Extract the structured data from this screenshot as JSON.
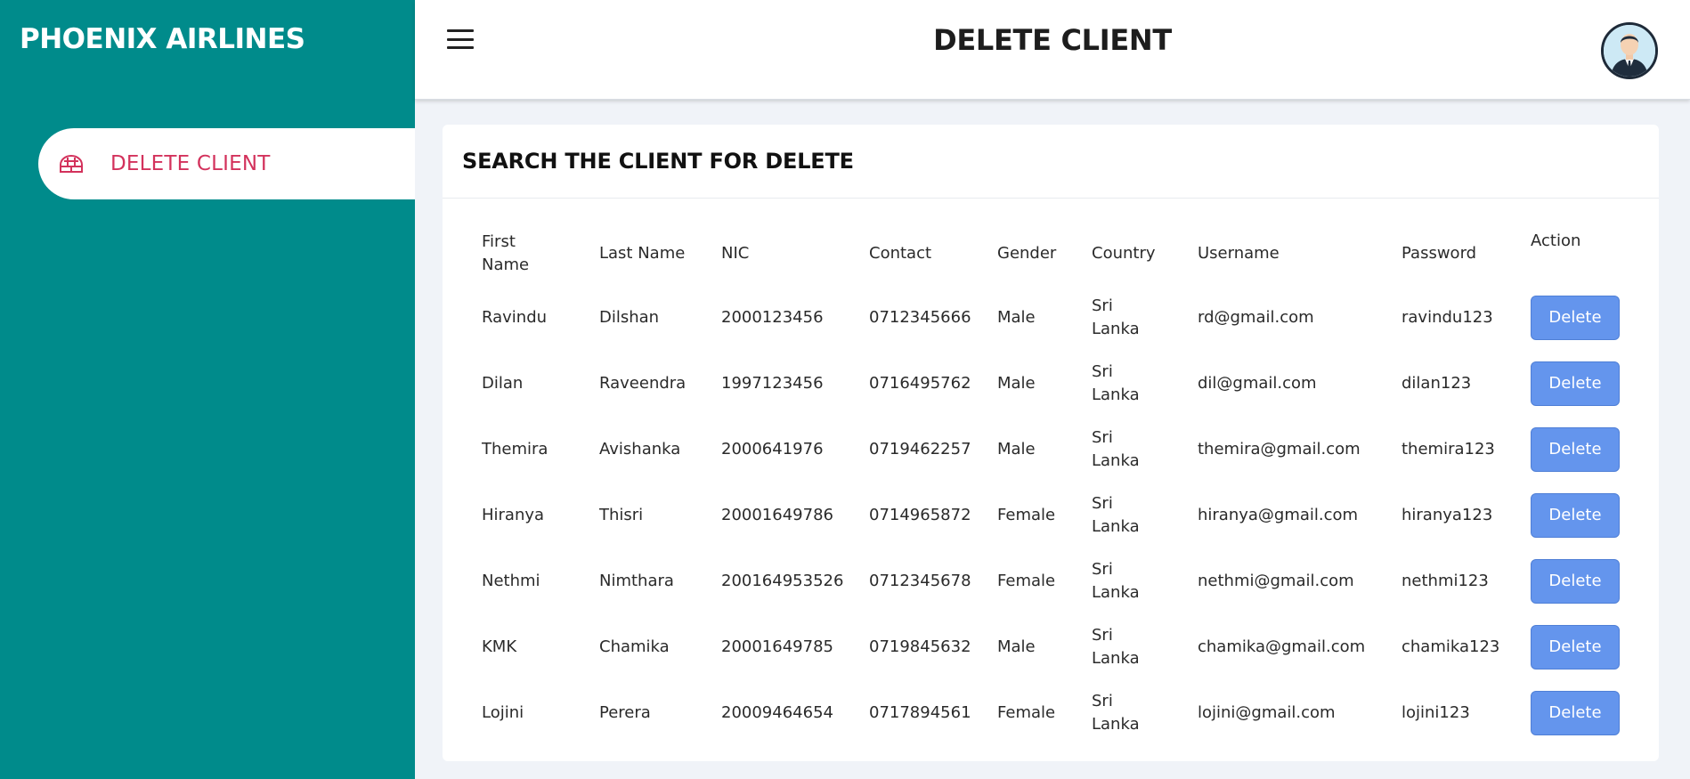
{
  "sidebar": {
    "brand": "PHOENIX AIRLINES",
    "items": [
      {
        "label": "DELETE CLIENT",
        "icon": "igloo-icon"
      }
    ]
  },
  "header": {
    "title": "DELETE CLIENT",
    "avatar_icon": "user-avatar"
  },
  "card": {
    "title": "SEARCH THE CLIENT FOR DELETE"
  },
  "table": {
    "columns": [
      "First Name",
      "Last Name",
      "NIC",
      "Contact",
      "Gender",
      "Country",
      "Username",
      "Password",
      "Action"
    ],
    "rows": [
      {
        "first": "Ravindu",
        "last": "Dilshan",
        "nic": "2000123456",
        "contact": "0712345666",
        "gender": "Male",
        "country": "Sri Lanka",
        "username": "rd@gmail.com",
        "password": "ravindu123",
        "action": "Delete"
      },
      {
        "first": "Dilan",
        "last": "Raveendra",
        "nic": "1997123456",
        "contact": "0716495762",
        "gender": "Male",
        "country": "Sri Lanka",
        "username": "dil@gmail.com",
        "password": "dilan123",
        "action": "Delete"
      },
      {
        "first": "Themira",
        "last": "Avishanka",
        "nic": "2000641976",
        "contact": "0719462257",
        "gender": "Male",
        "country": "Sri Lanka",
        "username": "themira@gmail.com",
        "password": "themira123",
        "action": "Delete"
      },
      {
        "first": "Hiranya",
        "last": "Thisri",
        "nic": "20001649786",
        "contact": "0714965872",
        "gender": "Female",
        "country": "Sri Lanka",
        "username": "hiranya@gmail.com",
        "password": "hiranya123",
        "action": "Delete"
      },
      {
        "first": "Nethmi",
        "last": "Nimthara",
        "nic": "200164953526",
        "contact": "0712345678",
        "gender": "Female",
        "country": "Sri Lanka",
        "username": "nethmi@gmail.com",
        "password": "nethmi123",
        "action": "Delete"
      },
      {
        "first": "KMK",
        "last": "Chamika",
        "nic": "20001649785",
        "contact": "0719845632",
        "gender": "Male",
        "country": "Sri Lanka",
        "username": "chamika@gmail.com",
        "password": "chamika123",
        "action": "Delete"
      },
      {
        "first": "Lojini",
        "last": "Perera",
        "nic": "20009464654",
        "contact": "0717894561",
        "gender": "Female",
        "country": "Sri Lanka",
        "username": "lojini@gmail.com",
        "password": "lojini123",
        "action": "Delete"
      }
    ]
  },
  "colors": {
    "sidebar_bg": "#008b8b",
    "accent_pink": "#d3325c",
    "button_blue": "#6495ed",
    "page_bg": "#f0f3f8"
  }
}
